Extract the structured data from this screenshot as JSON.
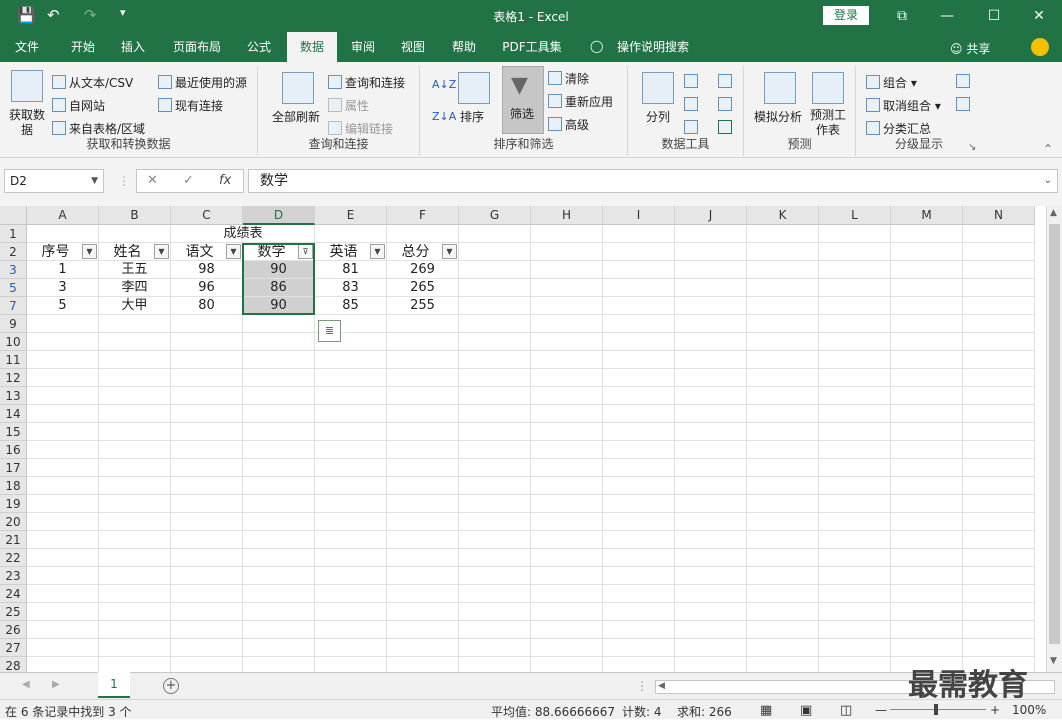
{
  "app": {
    "doc_title": "表格1  -  Excel",
    "login": "登录",
    "win_min": "—",
    "win_max": "☐",
    "win_close": "✕",
    "win_ribbon": "⧉"
  },
  "menu": {
    "tabs": [
      "文件",
      "开始",
      "插入",
      "页面布局",
      "公式",
      "数据",
      "审阅",
      "视图",
      "帮助",
      "PDF工具集",
      "操作说明搜索"
    ],
    "active": "数据",
    "share": "共享"
  },
  "ribbon": {
    "get_data": {
      "big": "获取数据",
      "from_text": "从文本/CSV",
      "from_web": "自网站",
      "from_table": "来自表格/区域",
      "recent": "最近使用的源",
      "existing": "现有连接",
      "label": "获取和转换数据"
    },
    "queries": {
      "refresh_all": "全部刷新",
      "queries_conn": "查询和连接",
      "properties": "属性",
      "edit_links": "编辑链接",
      "label": "查询和连接"
    },
    "sort_filter": {
      "sort": "排序",
      "filter": "筛选",
      "clear": "清除",
      "reapply": "重新应用",
      "advanced": "高级",
      "label": "排序和筛选"
    },
    "data_tools": {
      "split": "分列",
      "label": "数据工具"
    },
    "forecast": {
      "whatif": "模拟分析",
      "sheet": "预测工作表",
      "label": "预测"
    },
    "outline": {
      "group": "组合",
      "ungroup": "取消组合",
      "subtotal": "分类汇总",
      "label": "分级显示"
    }
  },
  "formula_bar": {
    "name_box": "D2",
    "cancel": "✕",
    "enter": "✓",
    "fx": "fx",
    "content": "数学"
  },
  "sheet": {
    "columns": [
      "A",
      "B",
      "C",
      "D",
      "E",
      "F",
      "G",
      "H",
      "I",
      "J",
      "K",
      "L",
      "M",
      "N"
    ],
    "selected_column": "D",
    "rows": [
      {
        "num": "1",
        "cells": []
      },
      {
        "num": "2",
        "cells": [
          "序号",
          "姓名",
          "语文",
          "数学",
          "英语",
          "总分"
        ]
      },
      {
        "num": "3",
        "cells": [
          "1",
          "王五",
          "98",
          "90",
          "81",
          "269"
        ]
      },
      {
        "num": "5",
        "cells": [
          "3",
          "李四",
          "96",
          "86",
          "83",
          "265"
        ]
      },
      {
        "num": "7",
        "cells": [
          "5",
          "大甲",
          "80",
          "90",
          "85",
          "255"
        ]
      },
      {
        "num": "9",
        "cells": []
      },
      {
        "num": "10",
        "cells": []
      },
      {
        "num": "11",
        "cells": []
      },
      {
        "num": "12",
        "cells": []
      },
      {
        "num": "13",
        "cells": []
      },
      {
        "num": "14",
        "cells": []
      },
      {
        "num": "15",
        "cells": []
      },
      {
        "num": "16",
        "cells": []
      },
      {
        "num": "17",
        "cells": []
      },
      {
        "num": "18",
        "cells": []
      },
      {
        "num": "19",
        "cells": []
      },
      {
        "num": "20",
        "cells": []
      },
      {
        "num": "21",
        "cells": []
      },
      {
        "num": "22",
        "cells": []
      },
      {
        "num": "23",
        "cells": []
      },
      {
        "num": "24",
        "cells": []
      },
      {
        "num": "25",
        "cells": []
      },
      {
        "num": "26",
        "cells": []
      },
      {
        "num": "27",
        "cells": []
      },
      {
        "num": "28",
        "cells": []
      }
    ],
    "title": "成绩表",
    "filtered_rows": [
      "3",
      "5",
      "7"
    ],
    "tab_name": "1"
  },
  "status": {
    "left": "在 6 条记录中找到 3 个",
    "average": "平均值: 88.66666667",
    "count": "计数: 4",
    "sum": "求和: 266",
    "zoom": "100%"
  },
  "watermark": "最需教育",
  "colors": {
    "accent": "#217346",
    "row_link": "#2b57c4"
  }
}
